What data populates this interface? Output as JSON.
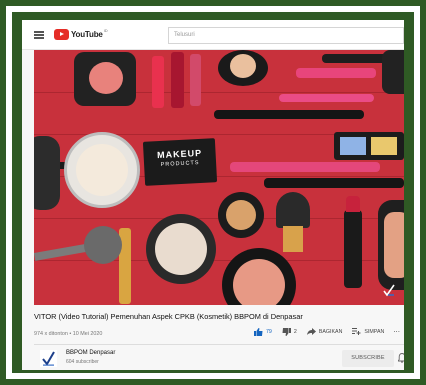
{
  "header": {
    "logo_text": "YouTube",
    "logo_region": "ID",
    "search_placeholder": "Telusuri"
  },
  "video": {
    "thumbnail": {
      "box_line1": "MAKEUP",
      "box_line2": "PRODUCTS"
    },
    "title": "VITOR (Video Tutorial) Pemenuhan Aspek CPKB (Kosmetik) BBPOM di Denpasar",
    "views_date": "974 x ditonton • 10 Mei 2020",
    "likes": "79",
    "dislikes": "2",
    "share_label": "BAGIKAN",
    "save_label": "SIMPAN",
    "more_label": "..."
  },
  "channel": {
    "name": "BBPOM Denpasar",
    "subscribers": "604 subscriber",
    "subscribe_label": "SUBSCRIBE"
  },
  "colors": {
    "frame_green": "#2f5a24",
    "youtube_red": "#e52d27",
    "like_blue": "#1565c0"
  }
}
